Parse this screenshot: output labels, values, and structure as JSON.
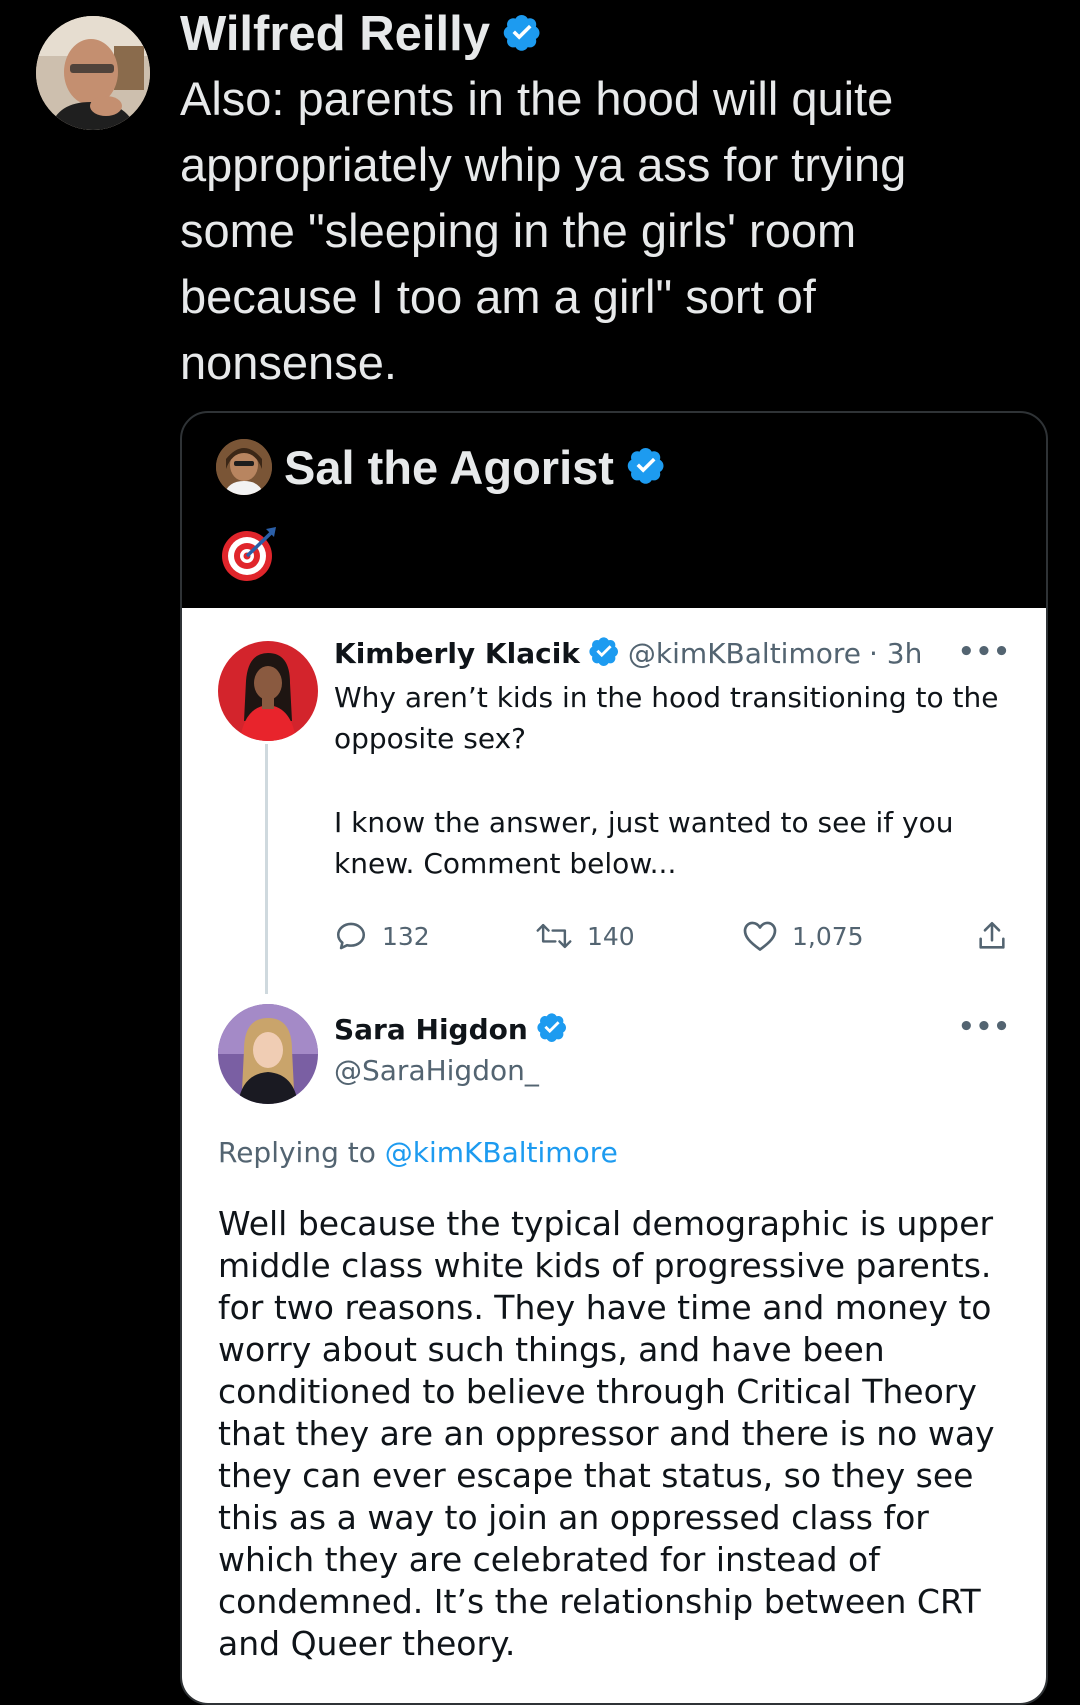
{
  "tweet": {
    "author_name": "Wilfred Reilly",
    "text": "Also: parents in the hood will quite appropriately whip ya ass for trying some \"sleeping in the girls' room because I too am a girl\" sort of nonsense.",
    "quoted": {
      "author_name": "Sal the Agorist",
      "emoji": "🎯",
      "image": {
        "original_tweet": {
          "author_name": "Kimberly Klacik",
          "handle": "@kimKBaltimore",
          "time": "· 3h",
          "text_line1": "Why aren’t kids in the hood transitioning to the opposite sex?",
          "text_line2": "I know the answer, just wanted to see if you knew. Comment below...",
          "replies": "132",
          "retweets": "140",
          "likes": "1,075"
        },
        "reply_tweet": {
          "author_name": "Sara Higdon",
          "handle": "@SaraHigdon_",
          "replying_prefix": "Replying to",
          "replying_to": "@kimKBaltimore",
          "text": "Well because the typical demographic is upper middle class white kids of progressive parents. for two reasons. They have time and money to worry about such things, and have been conditioned to believe through Critical Theory that they are an oppressor and there is no way they can ever escape that status, so they see this as a way to join an oppressed class for which they are celebrated for instead of condemned. It’s the relationship between CRT and Queer theory."
        }
      }
    }
  },
  "colors": {
    "background": "#000000",
    "text_primary": "#e7e9ea",
    "verified_blue": "#1d9bf0",
    "card_border": "#2f3336",
    "light_text": "#0f1419",
    "light_muted": "#536471"
  },
  "icons": {
    "verified": "verified-badge-icon",
    "more": "more-dots-icon",
    "reply": "reply-icon",
    "retweet": "retweet-icon",
    "like": "heart-icon",
    "share": "share-icon"
  }
}
